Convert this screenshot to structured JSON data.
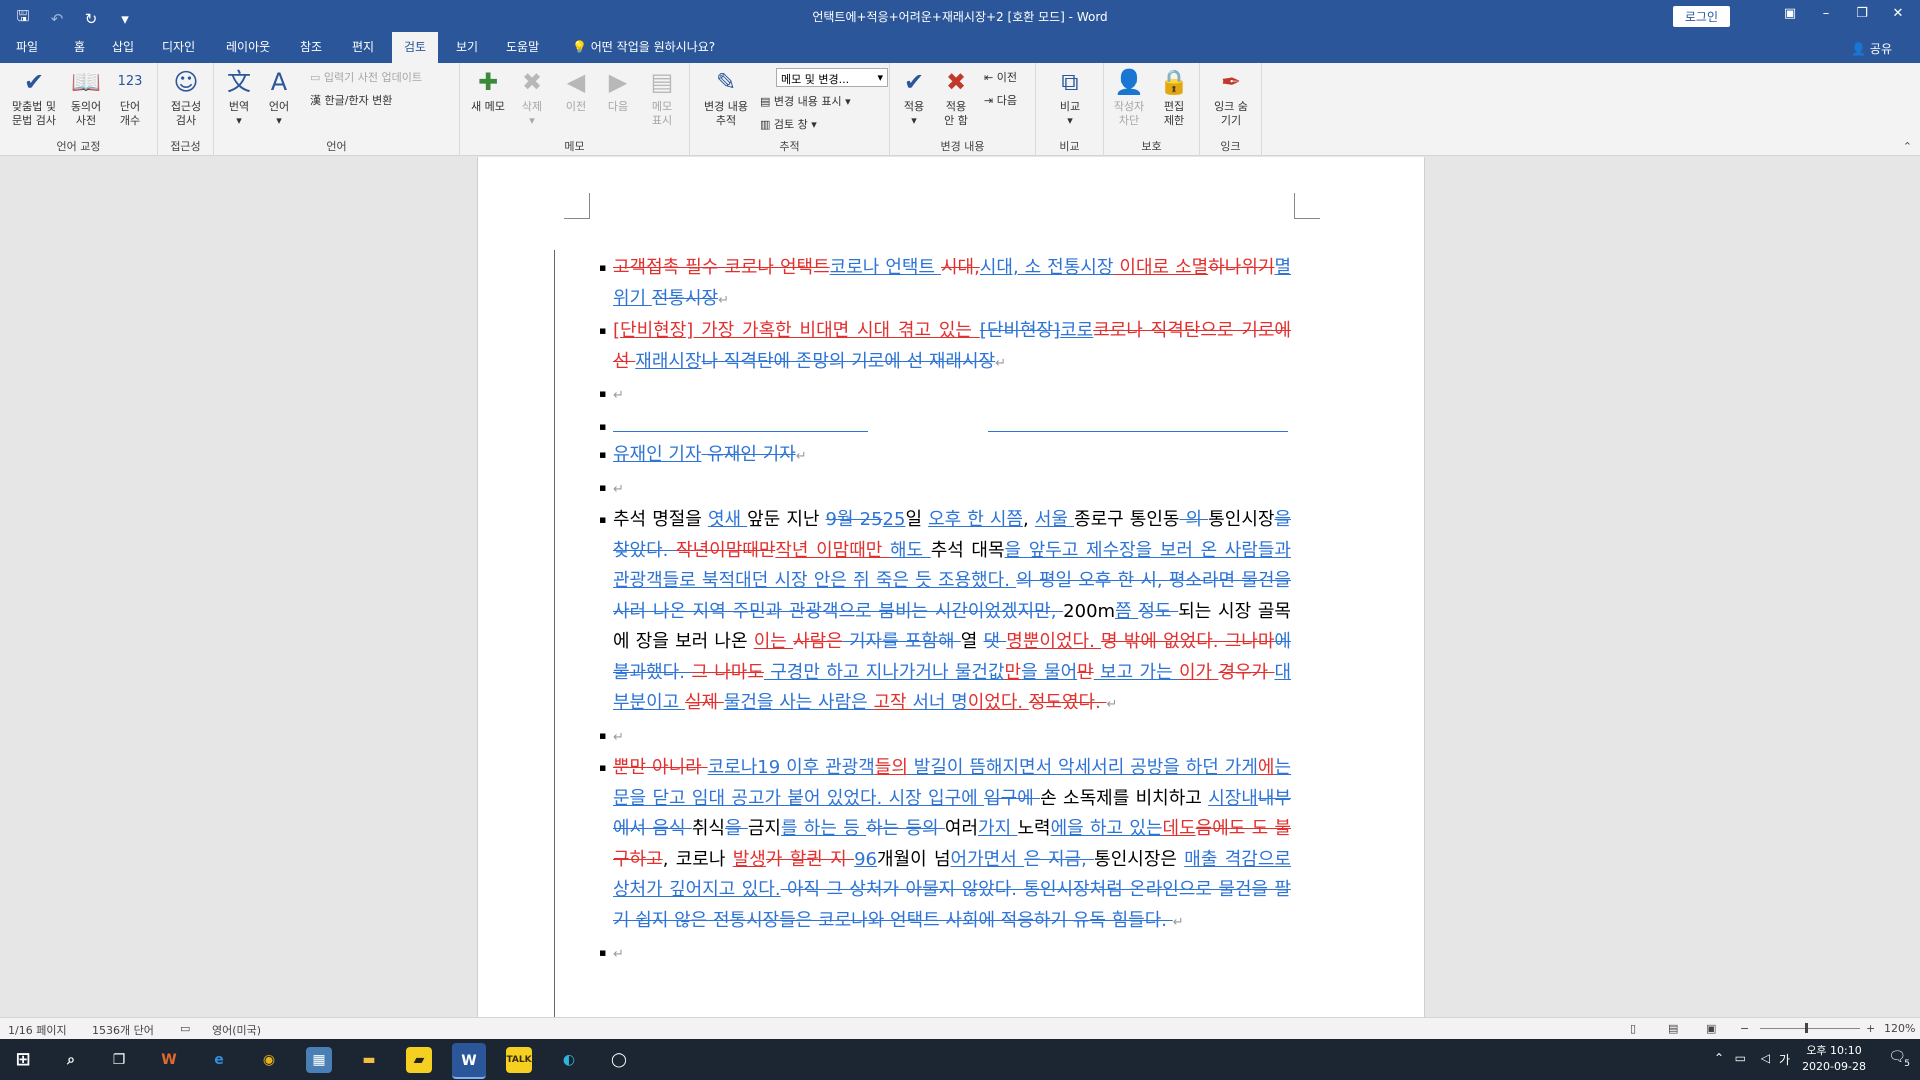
{
  "window": {
    "title": "언택트에+적응+어려운+재래시장+2 [호환 모드]  -  Word",
    "login": "로그인",
    "qat_icons": [
      "save-icon",
      "undo-icon",
      "redo-icon",
      "customize-icon"
    ]
  },
  "tabs": [
    "파일",
    "홈",
    "삽입",
    "디자인",
    "레이아웃",
    "참조",
    "편지",
    "검토",
    "보기",
    "도움말"
  ],
  "tell_me": "어떤 작업을 원하시나요?",
  "share": "공유",
  "ribbon": {
    "groups": {
      "proofing": "언어 교정",
      "accessibility": "접근성",
      "language": "언어",
      "comments": "메모",
      "tracking": "추적",
      "changes": "변경 내용",
      "compare": "비교",
      "protect": "보호",
      "ink": "잉크"
    },
    "buttons": {
      "spelling": "맞춤법 및\n문법 검사",
      "thesaurus": "동의어\n사전",
      "wordcount": "단어\n개수",
      "accessibility_check": "접근성\n검사",
      "translate": "번역",
      "language": "언어",
      "ime_update": "입력기 사전 업데이트",
      "hanja": "한글/한자 변환",
      "new_comment": "새 메모",
      "delete": "삭제",
      "previous": "이전",
      "next": "다음",
      "show_comments": "메모\n표시",
      "track_changes": "변경 내용\n추적",
      "markup_dropdown": "메모 및 변경...",
      "show_markup": "변경 내용 표시",
      "review_pane": "검토 창",
      "accept": "적용",
      "reject": "적용\n안 함",
      "change_prev": "이전",
      "change_next": "다음",
      "compare": "비교",
      "block_authors": "작성자\n차단",
      "restrict_editing": "편집\n제한",
      "hide_ink": "잉크 숨\n기기"
    },
    "gly": {
      "spelling": "✔",
      "thesaurus": "📖",
      "wordcount": "123",
      "accessibility_check": "☺",
      "translate": "文",
      "language": "A",
      "new_comment": "✚",
      "delete": "✖",
      "previous": "◀",
      "next": "▶",
      "show_comments": "▤",
      "track_changes": "✎",
      "accept": "✔",
      "reject": "✖",
      "compare": "⧉",
      "block_authors": "👤",
      "restrict_editing": "🔒",
      "hide_ink": "✒"
    }
  },
  "document": {
    "p1": [
      {
        "t": "del",
        "v": "고객접촉 필수 코로나 언택트"
      },
      {
        "t": "ins",
        "v": "코로나 언택트 "
      },
      {
        "t": "del",
        "v": " 시대,"
      },
      {
        "t": "ins",
        "v": "시대, 소 전통시장"
      },
      {
        "t": "insred",
        "v": " 이대로 소멸"
      },
      {
        "t": "del",
        "v": "하나위기"
      },
      {
        "t": "ins",
        "v": "멸위기 "
      },
      {
        "t": "delblue",
        "v": "전통시장"
      }
    ],
    "p2": [
      {
        "t": "insred",
        "v": "[단비현장] 가장 가혹한 비대면 시대 겪고 있는 "
      },
      {
        "t": "delblue",
        "v": "[단비현장]"
      },
      {
        "t": "ins",
        "v": "코로"
      },
      {
        "t": "del",
        "v": "코로나 직격탄으로 기로에 선 "
      },
      {
        "t": "ins",
        "v": "재래시장"
      },
      {
        "t": "delblue",
        "v": "나 직격탄에 존망의 기로에 선 재래시장"
      }
    ],
    "p3": [
      {
        "t": "del",
        "v": " "
      }
    ],
    "p4a": "",
    "p4b": [
      {
        "t": "ins",
        "v": "유재인 기자"
      },
      {
        "t": "delblue",
        "v": "        유재인 기자"
      }
    ],
    "p5": [],
    "p6": [
      {
        "t": "n",
        "v": "추석 명절을 "
      },
      {
        "t": "ins",
        "v": "엿새 "
      },
      {
        "t": "n",
        "v": "앞둔 지난 "
      },
      {
        "t": "delblue",
        "v": "9월 25"
      },
      {
        "t": "ins",
        "v": "25"
      },
      {
        "t": "n",
        "v": "일 "
      },
      {
        "t": "ins",
        "v": "오후 한 시쯤"
      },
      {
        "t": "n",
        "v": ", "
      },
      {
        "t": "ins",
        "v": "서울 "
      },
      {
        "t": "n",
        "v": "종로구 통인동"
      },
      {
        "t": "delblue",
        "v": " 의 "
      },
      {
        "t": "n",
        "v": "통인시장"
      },
      {
        "t": "delblue",
        "v": "을 찾았다. "
      },
      {
        "t": "del",
        "v": "작년이맘때만"
      },
      {
        "t": "insred",
        "v": "작년 이맘때만 "
      },
      {
        "t": "ins",
        "v": "해도 "
      },
      {
        "t": "n",
        "v": "추석 대목"
      },
      {
        "t": "ins",
        "v": "을 앞두고 제수장을 보러 온 사람들과 관광객들로 북적대던 시장 안은 쥐 죽은 듯 조용했다. "
      },
      {
        "t": "delblue",
        "v": "의 평일 오후 한 시, 평소라면 물건을 사러 나온 지역 주민과 관광객으로 붐비는 시간이었겠지만, "
      },
      {
        "t": "n",
        "v": "200m"
      },
      {
        "t": "ins",
        "v": "쯤 "
      },
      {
        "t": "delblue",
        "v": " 정도 "
      },
      {
        "t": "n",
        "v": "되는 시장 골목에 "
      },
      {
        "t": "delblue",
        "v": " "
      },
      {
        "t": "n",
        "v": "장을 보러 나온 "
      },
      {
        "t": "insred",
        "v": "이는 "
      },
      {
        "t": "del",
        "v": "사람은"
      },
      {
        "t": "delblue",
        "v": " 기자를 포함해 "
      },
      {
        "t": "n",
        "v": "열 "
      },
      {
        "t": "delblue",
        "v": "댓 "
      },
      {
        "t": "insred",
        "v": "명뿐이었다. "
      },
      {
        "t": "del",
        "v": " 명 밖에 없었다. 그나마"
      },
      {
        "t": "delblue",
        "v": "에 불과했다. "
      },
      {
        "t": "del",
        "v": "그 나마도"
      },
      {
        "t": "ins",
        "v": " 구경만 하고 지나가거나 물건값"
      },
      {
        "t": "insred",
        "v": "만"
      },
      {
        "t": "ins",
        "v": "을 물어"
      },
      {
        "t": "del",
        "v": "만"
      },
      {
        "t": "ins",
        "v": " 보고 가는 "
      },
      {
        "t": "insred",
        "v": "이가 "
      },
      {
        "t": "del",
        "v": "경우가 "
      },
      {
        "t": "ins",
        "v": "대부분이고 "
      },
      {
        "t": "del",
        "v": "실제 "
      },
      {
        "t": "ins",
        "v": "물건을 사는 사람은 "
      },
      {
        "t": "insred",
        "v": "고작 "
      },
      {
        "t": "ins",
        "v": "서너 명"
      },
      {
        "t": "insred",
        "v": "이었다. "
      },
      {
        "t": "del",
        "v": " 정도였다. "
      }
    ],
    "p7": [],
    "p8": [
      {
        "t": "del",
        "v": "뿐만 아니라 "
      },
      {
        "t": "ins",
        "v": "코로나19 이후 관광객"
      },
      {
        "t": "insred",
        "v": "들의"
      },
      {
        "t": "ins",
        "v": " 발길이 뜸해지면서 악세서리 공방을 하던 가게"
      },
      {
        "t": "insred",
        "v": "에"
      },
      {
        "t": "ins",
        "v": "는 문을 닫고 임대 공고가 붙어 있었다. 시장 입구에 "
      },
      {
        "t": "delblue",
        "v": "입구에 "
      },
      {
        "t": "n",
        "v": "손 소독제를 비치하고 "
      },
      {
        "t": "ins",
        "v": "시장내"
      },
      {
        "t": "delblue",
        "v": "내부에서 음식 "
      },
      {
        "t": "n",
        "v": "취식"
      },
      {
        "t": "delblue",
        "v": "을 "
      },
      {
        "t": "n",
        "v": "금지"
      },
      {
        "t": "ins",
        "v": "를 하는 등 "
      },
      {
        "t": "delblue",
        "v": "하는 등의 "
      },
      {
        "t": "n",
        "v": "여러"
      },
      {
        "t": "ins",
        "v": "가지 "
      },
      {
        "t": "n",
        "v": "노력"
      },
      {
        "t": "ins",
        "v": "에을 하고 있는"
      },
      {
        "t": "insred",
        "v": "데도"
      },
      {
        "t": "del",
        "v": "음에도 도 불구하고"
      },
      {
        "t": "n",
        "v": ", 코로나 "
      },
      {
        "t": "insred",
        "v": "발생"
      },
      {
        "t": "del",
        "v": "가 할퀸 지 "
      },
      {
        "t": "ins",
        "v": "96"
      },
      {
        "t": "n",
        "v": "개월이 넘"
      },
      {
        "t": "ins",
        "v": "어가면서 "
      },
      {
        "t": "delblue",
        "v": "은 지금, "
      },
      {
        "t": "n",
        "v": "통인시장은 "
      },
      {
        "t": "ins",
        "v": "매출 격감으로 상처가 깊어지고 있다."
      },
      {
        "t": "delblue",
        "v": " 아직 그 상처가 아물지 않았다. 통인시장처럼 온라인으로 물건을 팔기 쉽지 않은 전통시장들은 코로나와 언택트 사회에 적응하기 유독 힘들다. "
      }
    ],
    "p9": []
  },
  "status": {
    "page": "1/16 페이지",
    "words": "1536개 단어",
    "language": "영어(미국)",
    "zoom": "120%"
  },
  "taskbar": {
    "time": "오후 10:10",
    "date": "2020-09-28",
    "ime": "가",
    "notifications": "5"
  }
}
